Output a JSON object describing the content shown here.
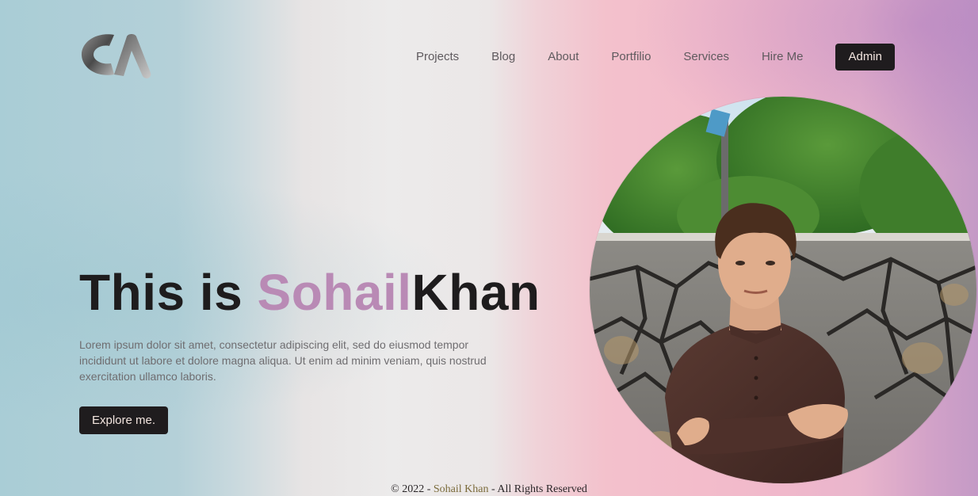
{
  "brand": {
    "logo_icon": "ca-monogram-logo"
  },
  "nav": {
    "items": [
      {
        "label": "Projects"
      },
      {
        "label": "Blog"
      },
      {
        "label": "About"
      },
      {
        "label": "Portfilio"
      },
      {
        "label": "Services"
      },
      {
        "label": "Hire Me"
      }
    ],
    "admin_label": "Admin"
  },
  "hero": {
    "title_prefix": "This is ",
    "title_accent": "Sohail",
    "title_suffix": "Khan",
    "description": "Lorem ipsum dolor sit amet, consectetur adipiscing elit, sed do eiusmod tempor incididunt ut labore et dolore magna aliqua. Ut enim ad minim veniam, quis nostrud exercitation ullamco laboris.",
    "cta_label": "Explore me."
  },
  "portrait": {
    "image": "profile-photo"
  },
  "footer": {
    "prefix": "© 2022 - ",
    "name": "Sohail Khan",
    "suffix": " - All Rights Reserved"
  },
  "colors": {
    "accent": "#b98ab5",
    "button_bg": "#1f1c1e",
    "button_text": "#f3e5df",
    "heading": "#1e1c1d"
  }
}
